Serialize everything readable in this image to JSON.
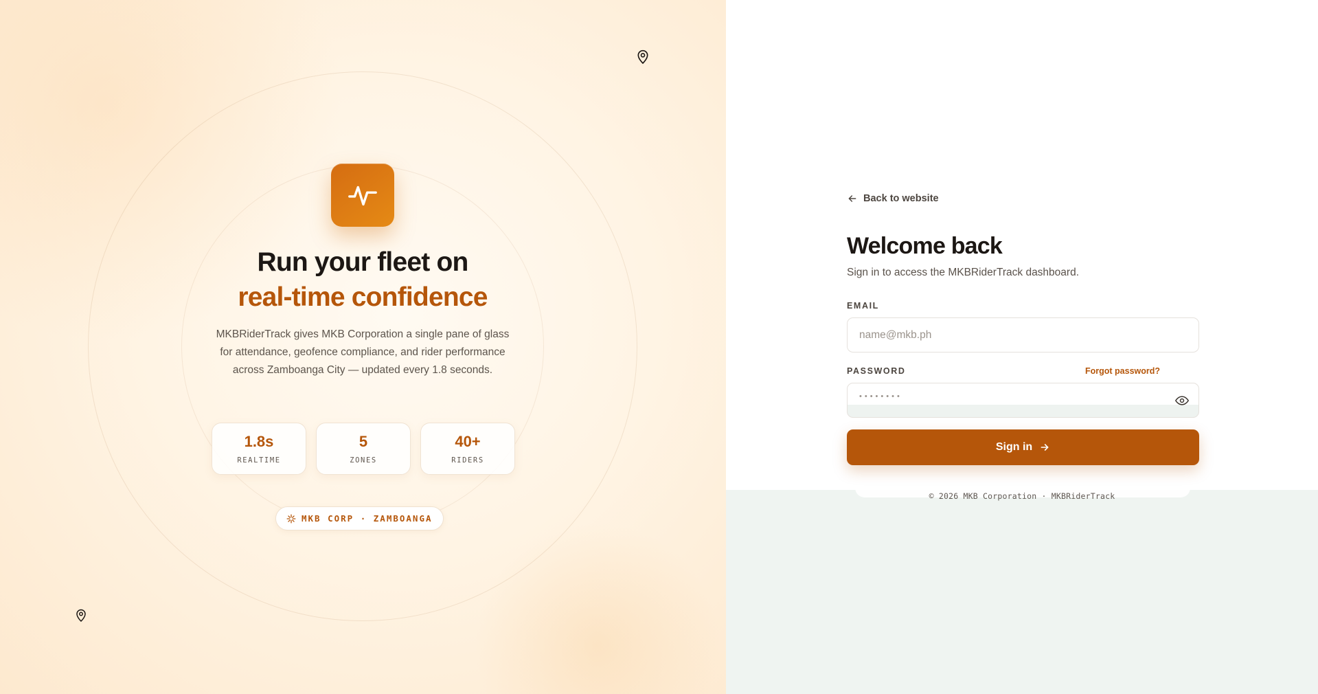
{
  "hero": {
    "title_line1": "Run your fleet on",
    "title_line2": "real-time confidence",
    "description": "MKBRiderTrack gives MKB Corporation a single pane of glass for attendance, geofence compliance, and rider performance across Zamboanga City — updated every 1.8 seconds.",
    "stats": [
      {
        "value": "1.8s",
        "label": "REALTIME"
      },
      {
        "value": "5",
        "label": "ZONES"
      },
      {
        "value": "40+",
        "label": "RIDERS"
      }
    ],
    "badge": "MKB CORP · ZAMBOANGA",
    "icons": {
      "app": "activity-pulse-icon",
      "pins": "map-pin-icon",
      "badge": "sparkle-icon"
    }
  },
  "auth": {
    "back_link": "Back to website",
    "title": "Welcome back",
    "subtitle": "Sign in to access the MKBRiderTrack dashboard.",
    "email_label": "EMAIL",
    "email_placeholder": "name@mkb.ph",
    "password_label": "PASSWORD",
    "forgot_link": "Forgot password?",
    "password_masked": "••••••••",
    "sign_in_label": "Sign in",
    "footer": "© 2026 MKB Corporation · MKBRiderTrack"
  },
  "colors": {
    "accent": "#b5560a",
    "icon_gradient_start": "#d56d12",
    "icon_gradient_end": "#e58a15",
    "footer_band": "#eff4f1"
  }
}
